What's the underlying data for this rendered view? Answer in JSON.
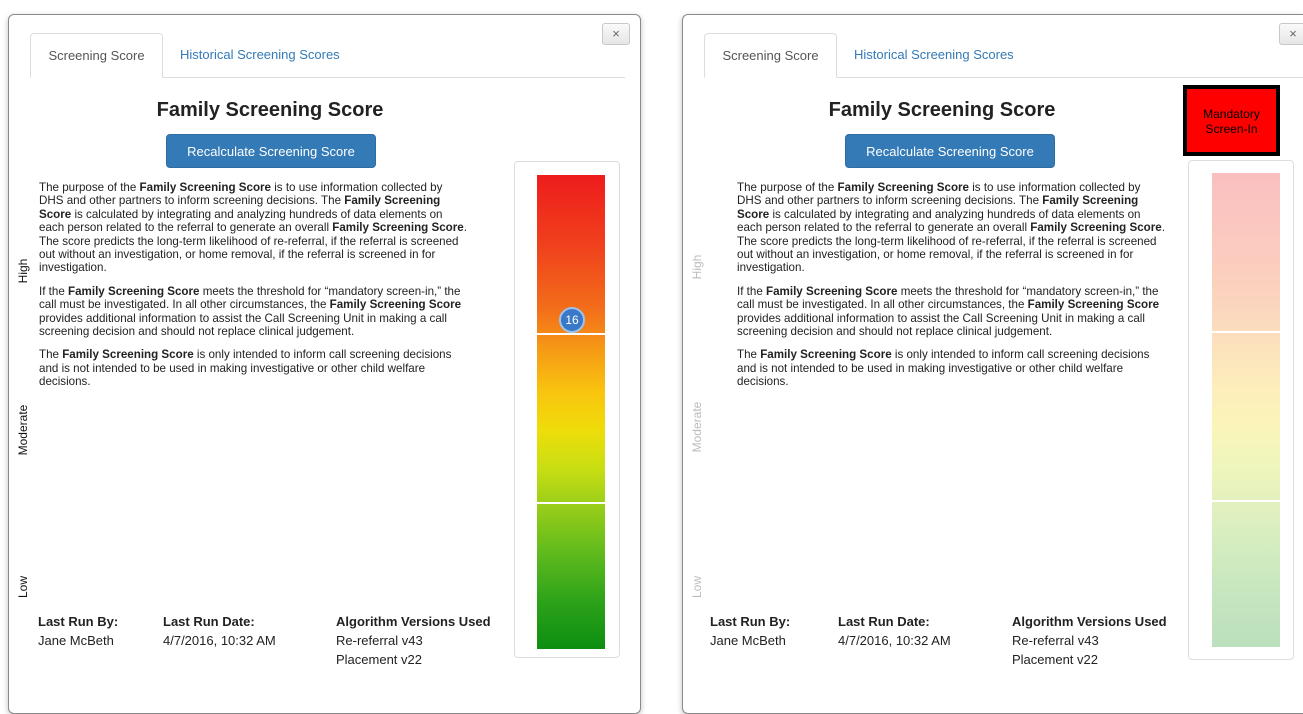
{
  "panels": [
    {
      "close_label": "×",
      "tabs": {
        "active": "Screening Score",
        "inactive": "Historical Screening Scores"
      },
      "title": "Family Screening Score",
      "recalc_button": "Recalculate Screening Score",
      "paragraphs": [
        [
          {
            "t": "The purpose of the "
          },
          {
            "b": "Family Screening Score"
          },
          {
            "t": " is to use information collected by DHS and other partners to inform screening decisions. The "
          },
          {
            "b": "Family Screening Score"
          },
          {
            "t": " is calculated by integrating and analyzing hundreds of data elements on each person related to the referral to generate an overall "
          },
          {
            "b": "Family Screening Score"
          },
          {
            "t": ".  The score predicts the long-term likelihood of re-referral, if the referral is screened out without an investigation, or home removal, if the referral is screened in for investigation."
          }
        ],
        [
          {
            "t": "If the "
          },
          {
            "b": "Family Screening Score"
          },
          {
            "t": " meets the threshold for “mandatory screen-in,” the call must be investigated. In all other circumstances, the "
          },
          {
            "b": "Family Screening Score"
          },
          {
            "t": " provides additional information to assist the Call Screening Unit in making a call screening decision and should not replace clinical judgement."
          }
        ],
        [
          {
            "t": "The "
          },
          {
            "b": "Family Screening Score"
          },
          {
            "t": " is only intended to inform call screening decisions and is not intended to be used in making investigative or other child welfare decisions."
          }
        ]
      ],
      "meta": {
        "last_run_by_label": "Last Run By:",
        "last_run_by": "Jane McBeth",
        "last_run_date_label": "Last Run Date:",
        "last_run_date": "4/7/2016, 10:32 AM",
        "algorithm_label": "Algorithm Versions Used",
        "algorithm_versions": [
          "Re-referral v43",
          "Placement v22"
        ]
      },
      "gauge": {
        "zones": [
          "High",
          "Moderate",
          "Low"
        ],
        "score": "16",
        "mandatory_label": "",
        "faded": false
      }
    },
    {
      "close_label": "×",
      "tabs": {
        "active": "Screening Score",
        "inactive": "Historical Screening Scores"
      },
      "title": "Family Screening Score",
      "recalc_button": "Recalculate Screening Score",
      "paragraphs": [
        [
          {
            "t": "The purpose of the "
          },
          {
            "b": "Family Screening Score"
          },
          {
            "t": " is to use information collected by DHS and other partners to inform screening decisions. The "
          },
          {
            "b": "Family Screening Score"
          },
          {
            "t": " is calculated by integrating and analyzing hundreds of data elements on each person related to the referral to generate an overall "
          },
          {
            "b": "Family Screening Score"
          },
          {
            "t": ".  The score predicts the long-term likelihood of re-referral, if the referral is screened out without an investigation, or home removal, if the referral is screened in for investigation."
          }
        ],
        [
          {
            "t": "If the "
          },
          {
            "b": "Family Screening Score"
          },
          {
            "t": " meets the threshold for “mandatory screen-in,” the call must be investigated. In all other circumstances, the "
          },
          {
            "b": "Family Screening Score"
          },
          {
            "t": " provides additional information to assist the Call Screening Unit in making a call screening decision and should not replace clinical judgement."
          }
        ],
        [
          {
            "t": "The "
          },
          {
            "b": "Family Screening Score"
          },
          {
            "t": " is only intended to inform call screening decisions and is not intended to be used in making investigative or other child welfare decisions."
          }
        ]
      ],
      "meta": {
        "last_run_by_label": "Last Run By:",
        "last_run_by": "Jane McBeth",
        "last_run_date_label": "Last Run Date:",
        "last_run_date": "4/7/2016, 10:32 AM",
        "algorithm_label": "Algorithm Versions Used",
        "algorithm_versions": [
          "Re-referral v43",
          "Placement v22"
        ]
      },
      "gauge": {
        "zones": [
          "High",
          "Moderate",
          "Low"
        ],
        "score": "",
        "mandatory_label": "Mandatory Screen-In",
        "faded": true
      }
    }
  ],
  "colors": {
    "primary_button": "#337ab7",
    "tab_link": "#337ab7",
    "score_badge": "#3a78c8",
    "mandatory_box": "#ff0000",
    "gauge_high": "#ee1c1c",
    "gauge_moderate": "#f9c50e",
    "gauge_low": "#0d8e12"
  },
  "icons": {
    "close": "close-icon"
  }
}
